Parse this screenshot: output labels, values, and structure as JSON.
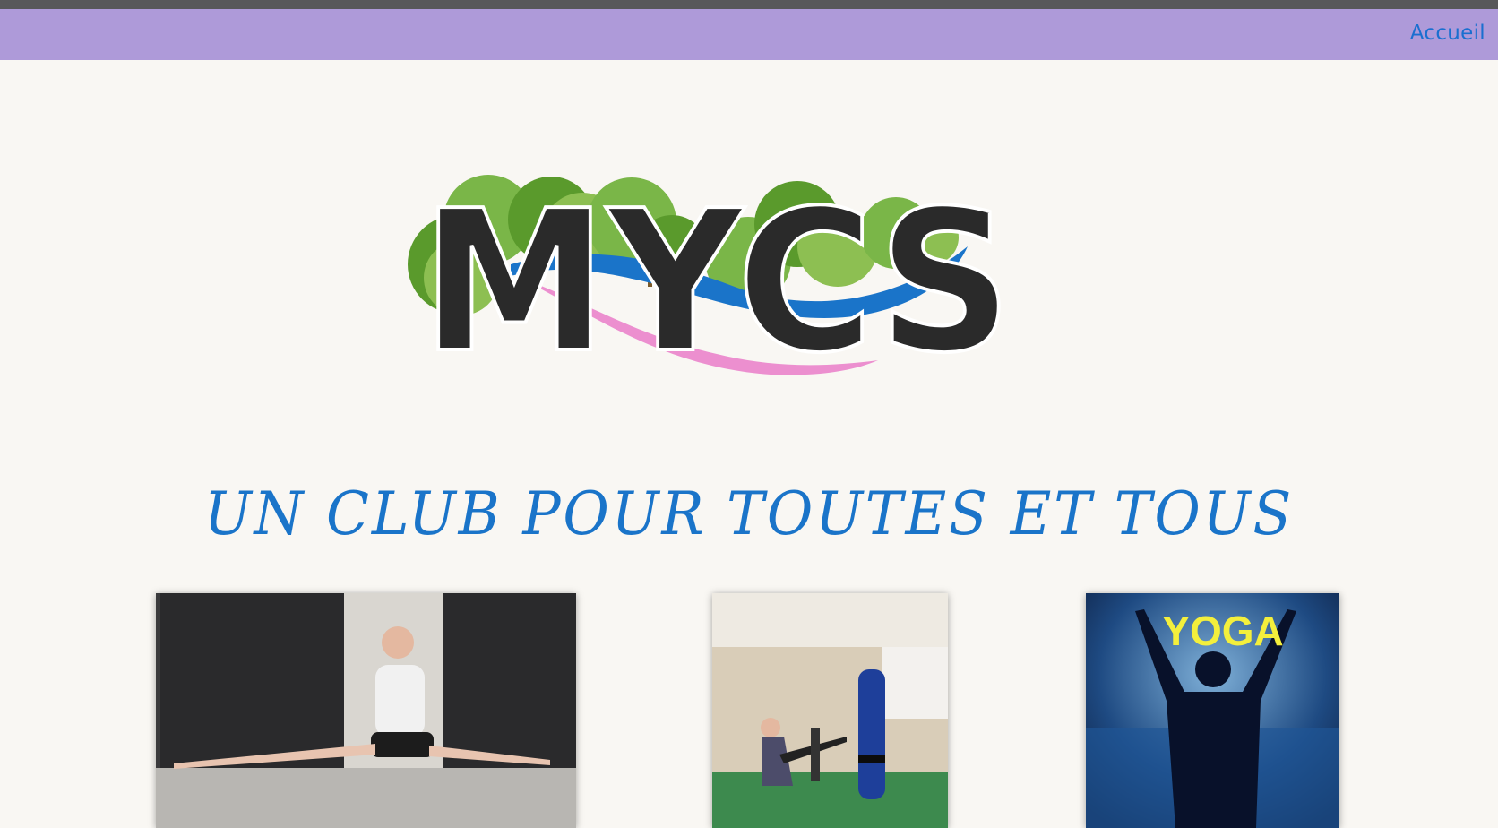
{
  "header": {
    "nav_link": "Accueil",
    "bar_color": "#ae9ad9",
    "top_strip_color": "#58585a",
    "link_color": "#1a6fd0"
  },
  "logo": {
    "text": "MYCS",
    "colors": {
      "letters": "#2a2a2a",
      "trees": "#7ab648",
      "river": "#1a74c9",
      "ribbon": "#ec8fcf"
    }
  },
  "tagline": "UN CLUB POUR TOUTES ET TOUS",
  "tagline_color": "#1a74c9",
  "photos": [
    {
      "name": "grand-ecart"
    },
    {
      "name": "boxe"
    },
    {
      "name": "yoga",
      "overlay_text": "YOGA"
    }
  ]
}
